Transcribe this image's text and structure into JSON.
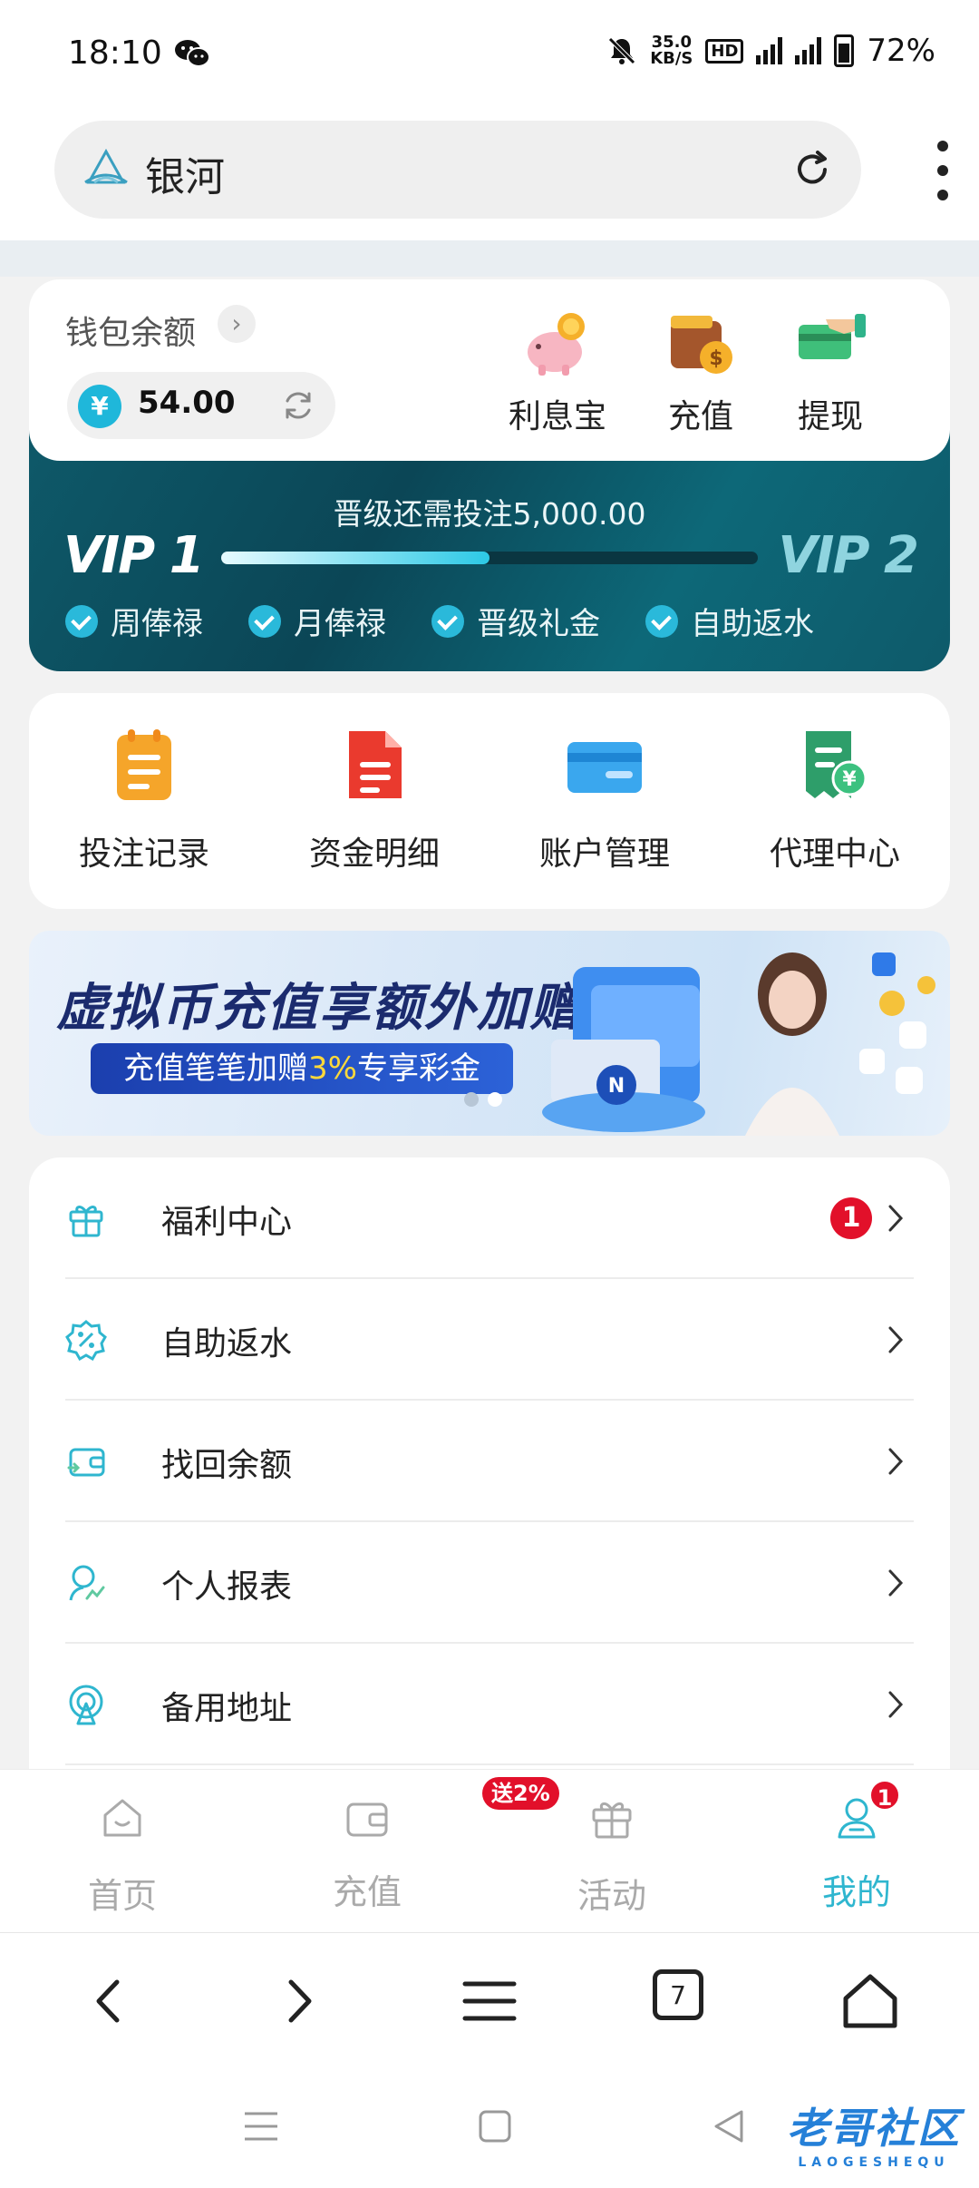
{
  "status_bar": {
    "time": "18:10",
    "net_speed_value": "35.0",
    "net_speed_unit": "KB/S",
    "hd_label": "HD",
    "battery": "72%"
  },
  "browser": {
    "site_name": "银河",
    "tab_count": "7"
  },
  "wallet": {
    "title": "钱包余额",
    "currency_symbol": "¥",
    "balance": "54.00",
    "actions": [
      "利息宝",
      "充值",
      "提现"
    ]
  },
  "vip": {
    "progress_text": "晋级还需投注5,000.00",
    "current_level": "VIP 1",
    "next_level": "VIP 2",
    "progress": 0.5,
    "perks": [
      "周俸禄",
      "月俸禄",
      "晋级礼金",
      "自助返水"
    ]
  },
  "quick_menu": [
    "投注记录",
    "资金明细",
    "账户管理",
    "代理中心"
  ],
  "banner": {
    "title": "虚拟币充值享额外加赠",
    "subtitle_prefix": "充值笔笔加赠",
    "subtitle_highlight": "3%",
    "subtitle_suffix": "专享彩金",
    "coin_label": "N"
  },
  "menu_list": [
    {
      "label": "福利中心",
      "badge": "1"
    },
    {
      "label": "自助返水"
    },
    {
      "label": "找回余额"
    },
    {
      "label": "个人报表"
    },
    {
      "label": "备用地址"
    }
  ],
  "tabbar": {
    "tabs": [
      "首页",
      "充值",
      "活动",
      "我的"
    ],
    "recharge_badge": "送2%",
    "mine_badge": "1"
  },
  "watermark": {
    "text": "老哥社区",
    "sub": "LAOGESHEQU"
  },
  "colors": {
    "accent": "#2fb6cf",
    "badge_red": "#e2102a",
    "vip_bg": "#0b4656"
  }
}
